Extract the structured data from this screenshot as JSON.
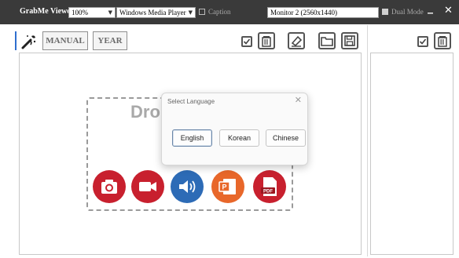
{
  "app": {
    "title": "GrabMe Viewer"
  },
  "toolbar": {
    "zoom": "100%",
    "player": "Windows Media Player",
    "caption_label": "Caption",
    "monitor": "Monitor 2 (2560x1440)",
    "dual_mode_label": "Dual Mode",
    "minimize": "_",
    "close": "✕"
  },
  "modes": {
    "manual": "MANUAL",
    "year": "YEAR"
  },
  "dropzone": {
    "text": "Dro"
  },
  "dialog": {
    "title": "Select Language",
    "close": "✕",
    "languages": [
      "English",
      "Korean",
      "Chinese"
    ],
    "selected": "English"
  },
  "media_icons": [
    {
      "name": "camera-icon",
      "color": "#c8202e"
    },
    {
      "name": "video-icon",
      "color": "#c8202e"
    },
    {
      "name": "audio-icon",
      "color": "#2d6bb6"
    },
    {
      "name": "powerpoint-icon",
      "color": "#e8672a"
    },
    {
      "name": "pdf-icon",
      "color": "#c8202e"
    }
  ],
  "colors": {
    "topbar": "#3a3a3a",
    "accent": "#2f6fcf"
  }
}
